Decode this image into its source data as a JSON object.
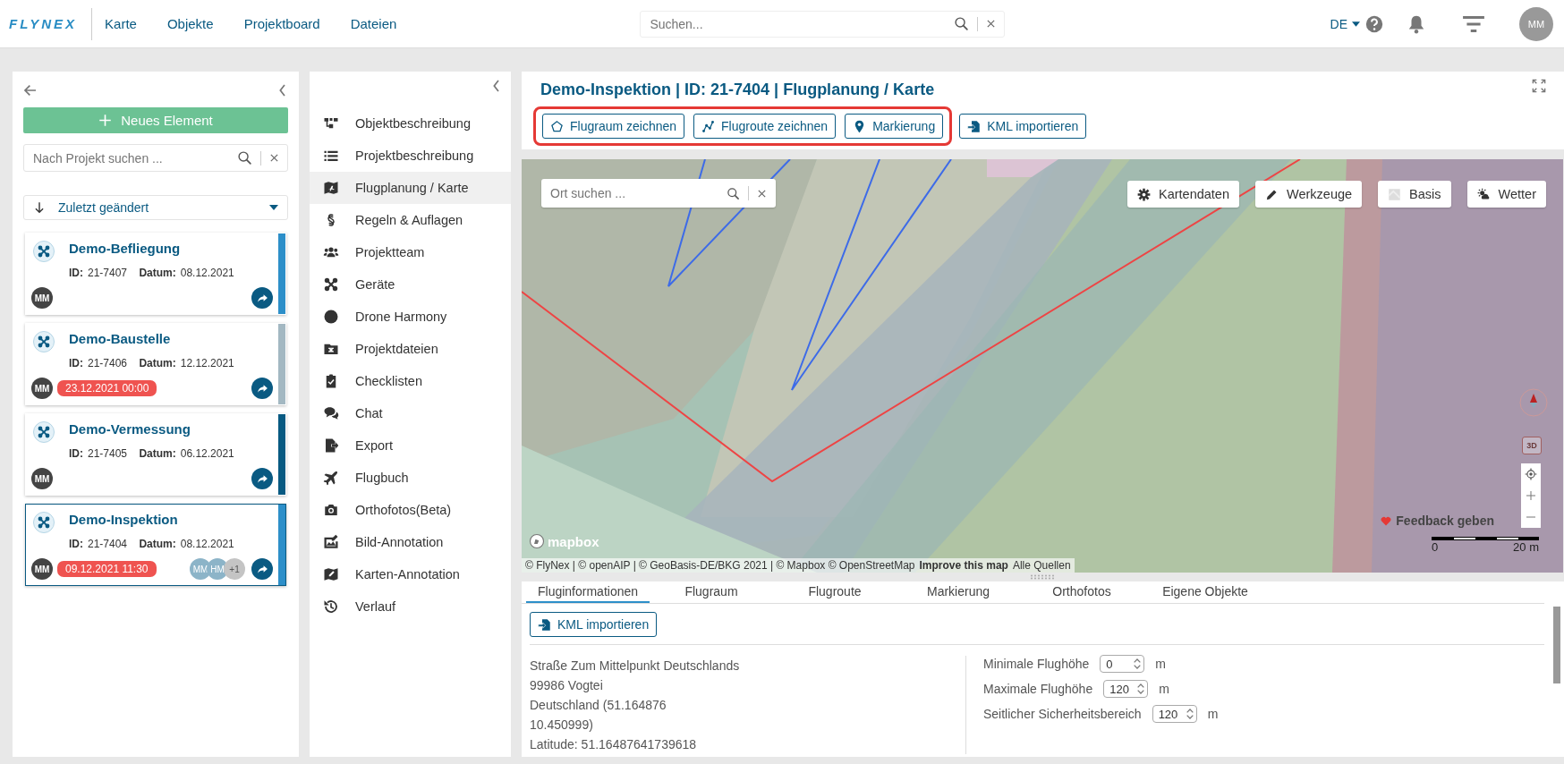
{
  "topbar": {
    "logo": "FLYNEX",
    "nav": [
      "Karte",
      "Objekte",
      "Projektboard",
      "Dateien"
    ],
    "search": {
      "placeholder": "Suchen..."
    },
    "language": "DE",
    "user": "MM"
  },
  "project_panel": {
    "new_button": "Neues Element",
    "search": {
      "placeholder": "Nach Projekt suchen ..."
    },
    "sort": "Zuletzt geändert",
    "cards": [
      {
        "title": "Demo-Befliegung",
        "id_label": "ID:",
        "id": "21-7407",
        "date_label": "Datum:",
        "date": "08.12.2021",
        "owner": "MM",
        "color": "#2d8fc9",
        "selected": false
      },
      {
        "title": "Demo-Baustelle",
        "id_label": "ID:",
        "id": "21-7406",
        "date_label": "Datum:",
        "date": "12.12.2021",
        "owner": "MM",
        "deadline": "23.12.2021 00:00",
        "color": "#a3b8c2",
        "selected": false
      },
      {
        "title": "Demo-Vermessung",
        "id_label": "ID:",
        "id": "21-7405",
        "date_label": "Datum:",
        "date": "06.12.2021",
        "owner": "MM",
        "color": "#085a82",
        "selected": false
      },
      {
        "title": "Demo-Inspektion",
        "id_label": "ID:",
        "id": "21-7404",
        "date_label": "Datum:",
        "date": "08.12.2021",
        "owner": "MM",
        "deadline": "09.12.2021 11:30",
        "members": [
          {
            "label": "MM",
            "kind": "user"
          },
          {
            "label": "HM",
            "kind": "user"
          },
          {
            "label": "+1",
            "kind": "more"
          }
        ],
        "color": "#2d8fc9",
        "selected": true
      }
    ]
  },
  "menu": {
    "items": [
      {
        "label": "Objektbeschreibung",
        "selected": false
      },
      {
        "label": "Projektbeschreibung",
        "selected": false
      },
      {
        "label": "Flugplanung / Karte",
        "selected": true
      },
      {
        "label": "Regeln & Auflagen",
        "selected": false
      },
      {
        "label": "Projektteam",
        "selected": false
      },
      {
        "label": "Geräte",
        "selected": false
      },
      {
        "label": "Drone Harmony",
        "selected": false
      },
      {
        "label": "Projektdateien",
        "selected": false
      },
      {
        "label": "Checklisten",
        "selected": false
      },
      {
        "label": "Chat",
        "selected": false
      },
      {
        "label": "Export",
        "selected": false
      },
      {
        "label": "Flugbuch",
        "selected": false
      },
      {
        "label": "Orthofotos(Beta)",
        "selected": false
      },
      {
        "label": "Bild-Annotation",
        "selected": false
      },
      {
        "label": "Karten-Annotation",
        "selected": false
      },
      {
        "label": "Verlauf",
        "selected": false
      }
    ]
  },
  "header": {
    "title": "Demo-Inspektion | ID: 21-7404 | Flugplanung / Karte",
    "actions": [
      {
        "label": "Flugraum zeichnen",
        "highlighted": true
      },
      {
        "label": "Flugroute zeichnen",
        "highlighted": true
      },
      {
        "label": "Markierung",
        "highlighted": true
      },
      {
        "label": "KML importieren",
        "highlighted": false
      }
    ]
  },
  "map": {
    "search": {
      "placeholder": "Ort suchen ..."
    },
    "buttons": [
      {
        "label": "Kartendaten",
        "disabled": false
      },
      {
        "label": "Werkzeuge",
        "disabled": false
      },
      {
        "label": "Basis",
        "disabled": false
      },
      {
        "label": "Wetter",
        "disabled": false
      }
    ],
    "compass_3d": "3D",
    "feedback": "Feedback geben",
    "scale": [
      "0",
      "20 m"
    ],
    "logo": "mapbox",
    "attribution": "© FlyNex | © openAIP | © GeoBasis-DE/BKG 2021 | © Mapbox © OpenStreetMap",
    "improve": "Improve this map",
    "sources": "Alle Quellen"
  },
  "details": {
    "tabs": [
      {
        "label": "Fluginformationen",
        "selected": true
      },
      {
        "label": "Flugraum",
        "selected": false
      },
      {
        "label": "Flugroute",
        "selected": false
      },
      {
        "label": "Markierung",
        "selected": false
      },
      {
        "label": "Orthofotos",
        "selected": false
      },
      {
        "label": "Eigene Objekte",
        "selected": false
      }
    ],
    "import_button": "KML importieren",
    "address": [
      "Straße Zum Mittelpunkt Deutschlands",
      "99986 Vogtei",
      "Deutschland (51.164876",
      "10.450999)",
      "Latitude: 51.16487641739618"
    ],
    "fields": [
      {
        "label": "Minimale Flughöhe",
        "value": "0",
        "unit": "m"
      },
      {
        "label": "Maximale Flughöhe",
        "value": "120",
        "unit": "m"
      },
      {
        "label": "Seitlicher Sicherheitsbereich",
        "value": "120",
        "unit": "m"
      }
    ]
  }
}
